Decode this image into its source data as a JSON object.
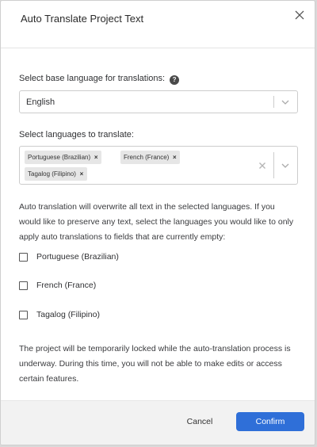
{
  "dialog": {
    "title": "Auto Translate Project Text"
  },
  "base_language": {
    "label": "Select base language for translations:",
    "help_icon": "question-circle-icon",
    "value": "English"
  },
  "target_languages": {
    "label": "Select languages to translate:",
    "selected": [
      {
        "label": "Portuguese (Brazilian)"
      },
      {
        "label": "French (France)"
      },
      {
        "label": "Tagalog (Filipino)"
      }
    ],
    "remove_glyph": "×"
  },
  "overwrite_note": "Auto translation will overwrite all text in the selected languages. If you would like to preserve any text, select the languages you would like to only apply auto translations to fields that are currently empty:",
  "empty_only_options": [
    {
      "label": "Portuguese (Brazilian)",
      "checked": false
    },
    {
      "label": "French (France)",
      "checked": false
    },
    {
      "label": "Tagalog (Filipino)",
      "checked": false
    }
  ],
  "lock_note": "The project will be temporarily locked while the auto-translation process is underway. During this time, you will not be able to make edits or access certain features.",
  "footer": {
    "cancel_label": "Cancel",
    "confirm_label": "Confirm"
  },
  "colors": {
    "primary": "#2f6fd8",
    "footer_bg": "#f2f2f2",
    "chip_bg": "#e6e6e6"
  }
}
